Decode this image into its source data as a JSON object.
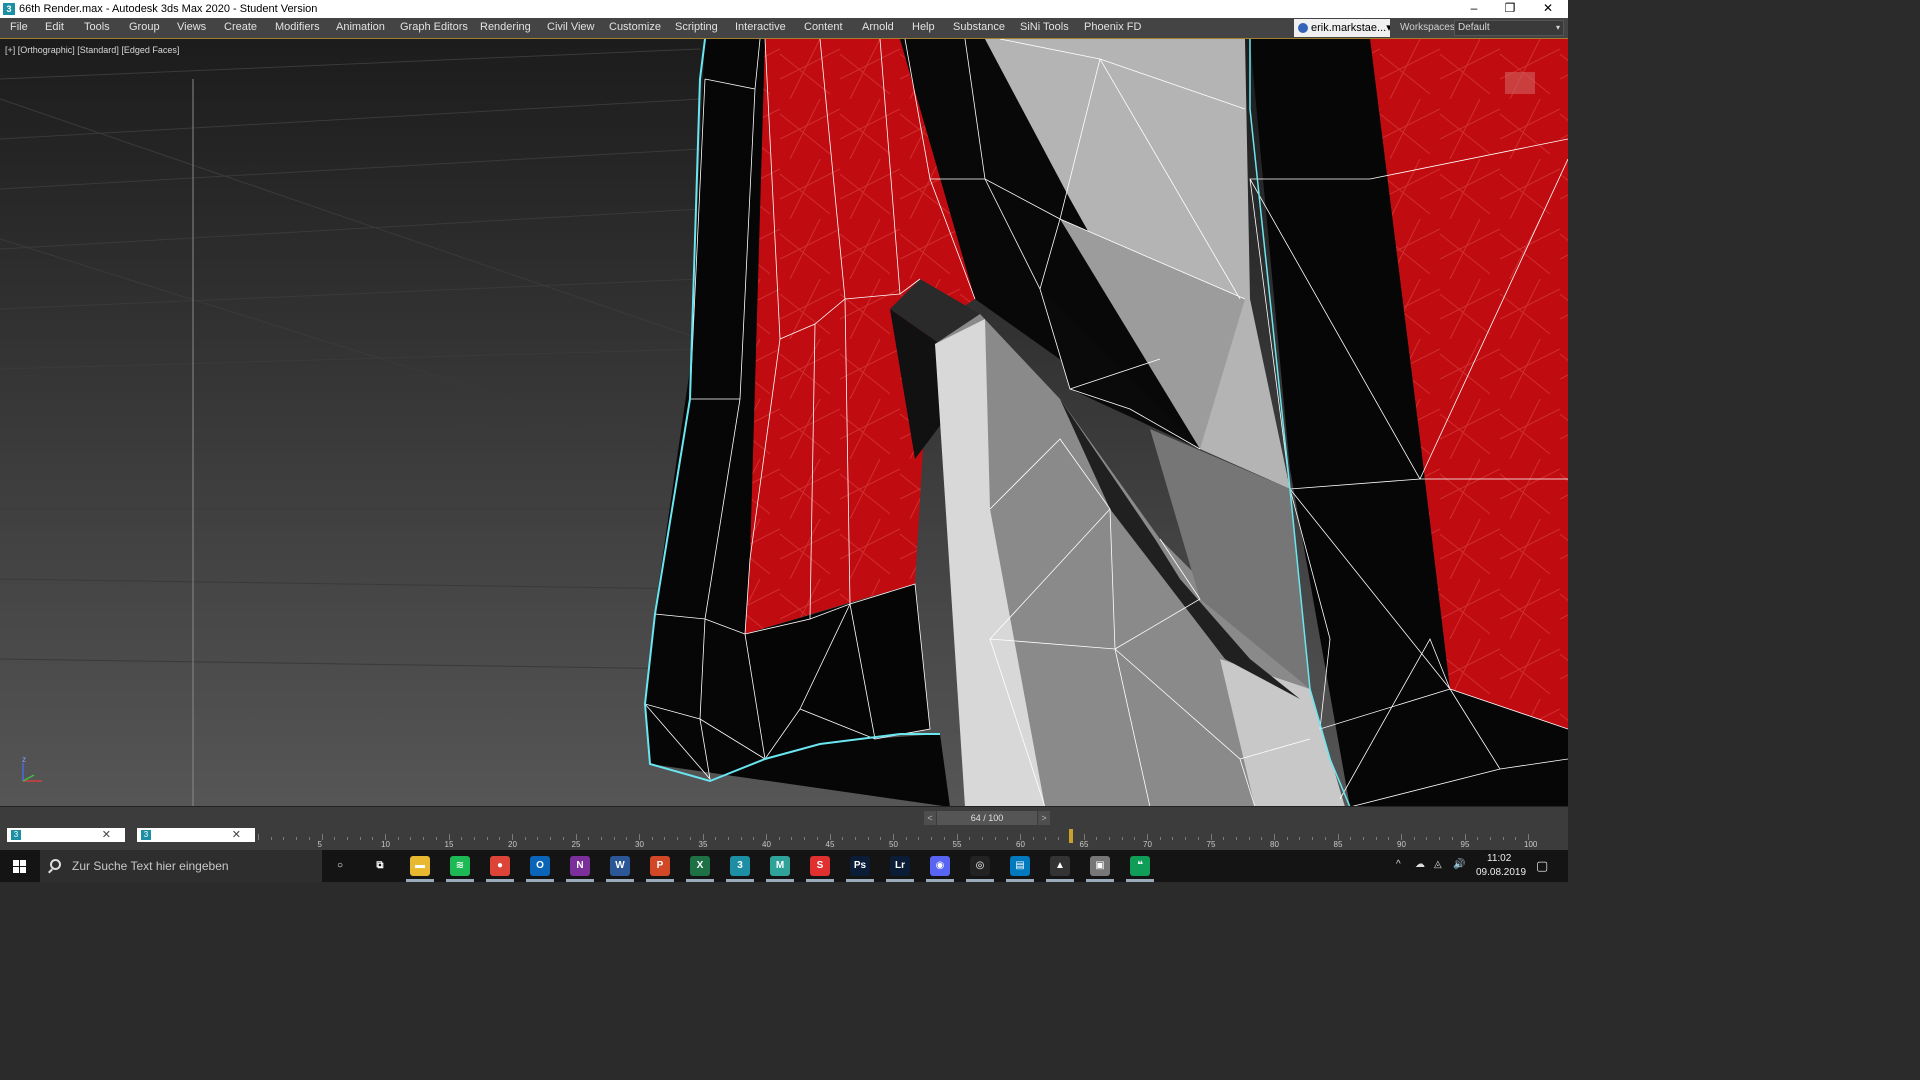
{
  "window": {
    "title": "66th Render.max - Autodesk 3ds Max 2020 - Student Version",
    "app_icon_glyph": "3",
    "minimize_glyph": "–",
    "restore_glyph": "❐",
    "close_glyph": "✕"
  },
  "menu": {
    "items": [
      "File",
      "Edit",
      "Tools",
      "Group",
      "Views",
      "Create",
      "Modifiers",
      "Animation",
      "Graph Editors",
      "Rendering",
      "Civil View",
      "Customize",
      "Scripting",
      "Interactive",
      "Content",
      "Arnold",
      "Help",
      "Substance",
      "SiNi Tools",
      "Phoenix FD"
    ],
    "user": "erik.markstae...",
    "user_chevron": "▾",
    "workspaces_label": "Workspaces:",
    "workspace_value": "Default",
    "workspace_chevron": "▾"
  },
  "viewport": {
    "label": "[+] [Orthographic] [Standard] [Edged Faces]",
    "axis_z": "z",
    "colors": {
      "red": "#c00c10",
      "selection": "#6ae6f0",
      "wire": "#ffffff"
    }
  },
  "timeline": {
    "frame_counter": "64 / 100",
    "prev_glyph": "<",
    "next_glyph": ">",
    "tab_icon_glyph": "3",
    "tab_close_glyph": "✕",
    "ruler_labels": [
      "5",
      "10",
      "15",
      "20",
      "25",
      "30",
      "35",
      "40",
      "45",
      "50",
      "55",
      "60",
      "65",
      "70",
      "75",
      "80",
      "85",
      "90",
      "95",
      "100"
    ],
    "current_frame": 64,
    "total_frames": 100
  },
  "taskbar": {
    "search_placeholder": "Zur Suche Text hier eingeben",
    "apps": [
      {
        "name": "cortana",
        "glyph": "○",
        "color": "#141414"
      },
      {
        "name": "task-view",
        "glyph": "⧉",
        "color": "#141414"
      },
      {
        "name": "file-explorer",
        "glyph": "▬",
        "color": "#e8b830"
      },
      {
        "name": "spotify",
        "glyph": "≋",
        "color": "#1db954"
      },
      {
        "name": "chrome",
        "glyph": "●",
        "color": "#db4437"
      },
      {
        "name": "outlook",
        "glyph": "O",
        "color": "#0a64b8"
      },
      {
        "name": "onenote",
        "glyph": "N",
        "color": "#7a2f9a"
      },
      {
        "name": "word",
        "glyph": "W",
        "color": "#2b5797"
      },
      {
        "name": "powerpoint",
        "glyph": "P",
        "color": "#d24726"
      },
      {
        "name": "excel",
        "glyph": "X",
        "color": "#1e7145"
      },
      {
        "name": "3dsmax",
        "glyph": "3",
        "color": "#1d8fa5"
      },
      {
        "name": "marvelous",
        "glyph": "M",
        "color": "#2fa39a"
      },
      {
        "name": "substance",
        "glyph": "S",
        "color": "#e03030"
      },
      {
        "name": "photoshop",
        "glyph": "Ps",
        "color": "#0b1c36"
      },
      {
        "name": "lightroom",
        "glyph": "Lr",
        "color": "#0b1c36"
      },
      {
        "name": "discord",
        "glyph": "◉",
        "color": "#5865f2"
      },
      {
        "name": "obs",
        "glyph": "◎",
        "color": "#222222"
      },
      {
        "name": "trello",
        "glyph": "▤",
        "color": "#0079bf"
      },
      {
        "name": "photos",
        "glyph": "▲",
        "color": "#333333"
      },
      {
        "name": "explorer-2",
        "glyph": "▣",
        "color": "#777777"
      },
      {
        "name": "hangouts",
        "glyph": "❝",
        "color": "#0f9d58"
      }
    ],
    "tray_glyphs": [
      "^",
      "☁",
      "◬",
      "🔊"
    ],
    "time": "11:02",
    "date": "09.08.2019",
    "notification_glyph": "▢"
  }
}
